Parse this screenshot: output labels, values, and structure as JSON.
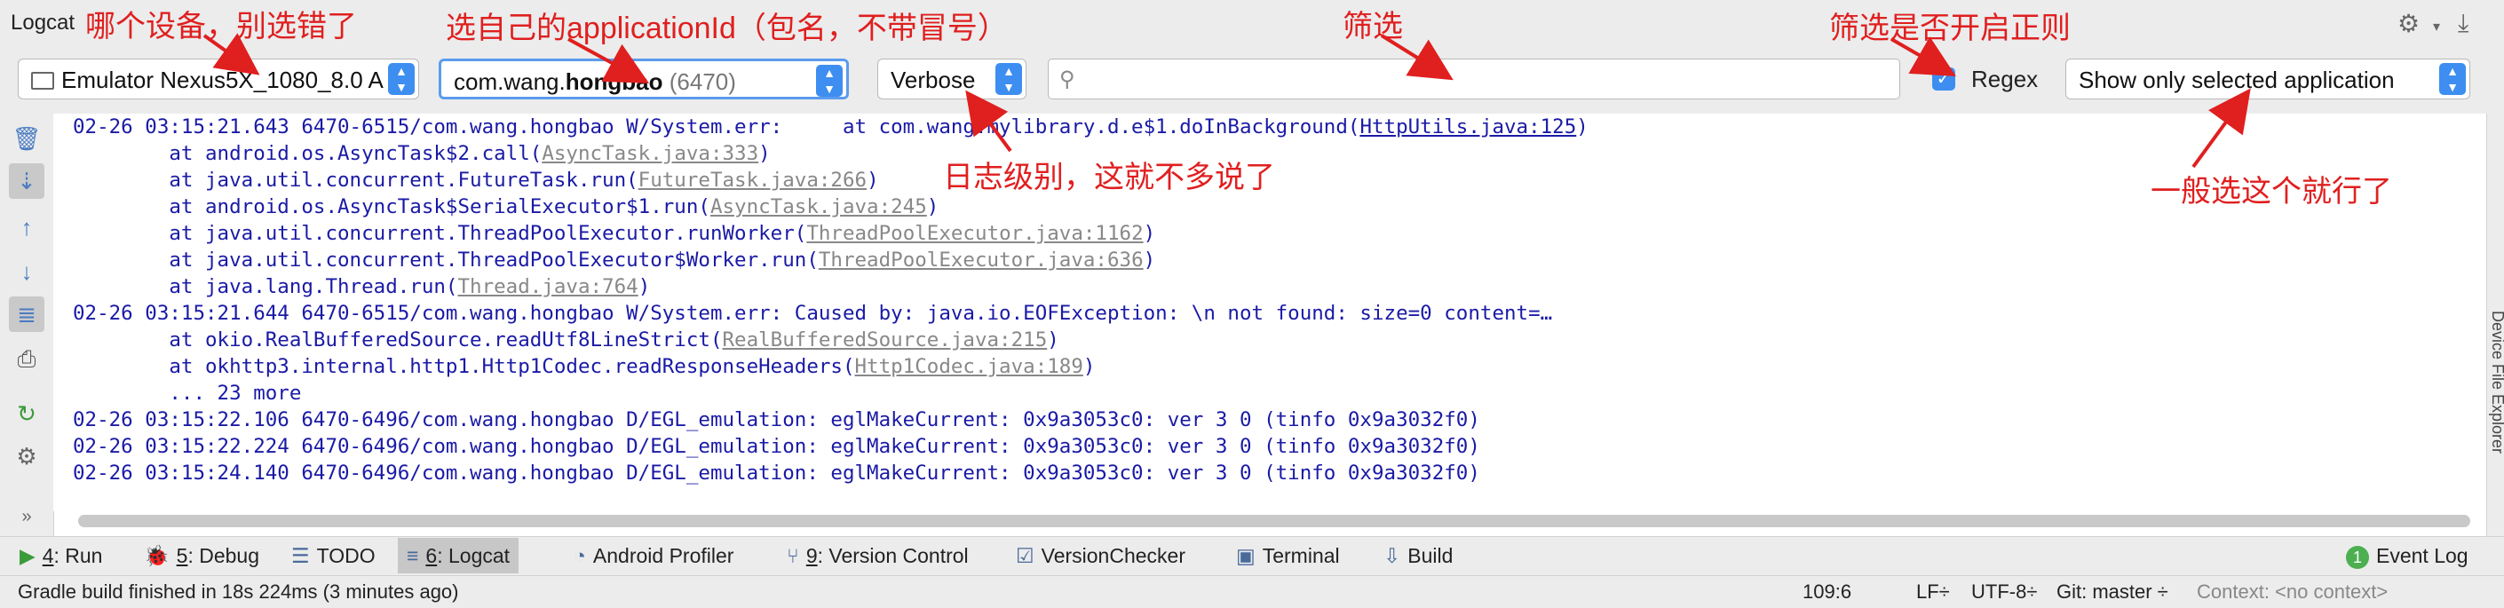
{
  "window": {
    "title": "Logcat"
  },
  "toolbar": {
    "device": "Emulator Nexus5X_1080_8.0 A",
    "app_package_prefix": "com.wang.",
    "app_package_bold": "hongbao",
    "app_pid": "(6470)",
    "log_level": "Verbose",
    "search_value": "",
    "regex_label": "Regex",
    "regex_checked": true,
    "filter_mode": "Show only selected application"
  },
  "log_lines": [
    {
      "text": "02-26 03:15:21.643 6470-6515/com.wang.hongbao W/System.err:     at com.wang.mylibrary.d.e$1.doInBackground(",
      "link": "HttpUtils.java:125",
      "suffix": ")",
      "link_style": "blue"
    },
    {
      "text": "        at android.os.AsyncTask$2.call(",
      "link": "AsyncTask.java:333",
      "suffix": ")",
      "link_style": "grey"
    },
    {
      "text": "        at java.util.concurrent.FutureTask.run(",
      "link": "FutureTask.java:266",
      "suffix": ")",
      "link_style": "grey"
    },
    {
      "text": "        at android.os.AsyncTask$SerialExecutor$1.run(",
      "link": "AsyncTask.java:245",
      "suffix": ")",
      "link_style": "grey"
    },
    {
      "text": "        at java.util.concurrent.ThreadPoolExecutor.runWorker(",
      "link": "ThreadPoolExecutor.java:1162",
      "suffix": ")",
      "link_style": "grey"
    },
    {
      "text": "        at java.util.concurrent.ThreadPoolExecutor$Worker.run(",
      "link": "ThreadPoolExecutor.java:636",
      "suffix": ")",
      "link_style": "grey"
    },
    {
      "text": "        at java.lang.Thread.run(",
      "link": "Thread.java:764",
      "suffix": ")",
      "link_style": "grey"
    },
    {
      "text": "02-26 03:15:21.644 6470-6515/com.wang.hongbao W/System.err: Caused by: java.io.EOFException: \\n not found: size=0 content=…",
      "link": "",
      "suffix": "",
      "link_style": "none"
    },
    {
      "text": "        at okio.RealBufferedSource.readUtf8LineStrict(",
      "link": "RealBufferedSource.java:215",
      "suffix": ")",
      "link_style": "grey"
    },
    {
      "text": "        at okhttp3.internal.http1.Http1Codec.readResponseHeaders(",
      "link": "Http1Codec.java:189",
      "suffix": ")",
      "link_style": "grey"
    },
    {
      "text": "        ... 23 more",
      "link": "",
      "suffix": "",
      "link_style": "none"
    },
    {
      "text": "02-26 03:15:22.106 6470-6496/com.wang.hongbao D/EGL_emulation: eglMakeCurrent: 0x9a3053c0: ver 3 0 (tinfo 0x9a3032f0)",
      "link": "",
      "suffix": "",
      "link_style": "none"
    },
    {
      "text": "02-26 03:15:22.224 6470-6496/com.wang.hongbao D/EGL_emulation: eglMakeCurrent: 0x9a3053c0: ver 3 0 (tinfo 0x9a3032f0)",
      "link": "",
      "suffix": "",
      "link_style": "none"
    },
    {
      "text": "02-26 03:15:24.140 6470-6496/com.wang.hongbao D/EGL_emulation: eglMakeCurrent: 0x9a3053c0: ver 3 0 (tinfo 0x9a3032f0)",
      "link": "",
      "suffix": "",
      "link_style": "none"
    }
  ],
  "right_strip_label": "Device File Explorer",
  "tabs": [
    {
      "key": "4",
      "label": ": Run",
      "icon": "run-icon"
    },
    {
      "key": "5",
      "label": ": Debug",
      "icon": "debug-icon"
    },
    {
      "key": "",
      "label": "TODO",
      "icon": "todo-icon"
    },
    {
      "key": "6",
      "label": ": Logcat",
      "icon": "logcat-icon",
      "active": true
    },
    {
      "key": "",
      "label": "Android Profiler",
      "icon": "profiler-icon"
    },
    {
      "key": "9",
      "label": ": Version Control",
      "icon": "version-control-icon"
    },
    {
      "key": "",
      "label": "VersionChecker",
      "icon": "version-checker-icon"
    },
    {
      "key": "",
      "label": "Terminal",
      "icon": "terminal-icon"
    },
    {
      "key": "",
      "label": "Build",
      "icon": "build-icon"
    }
  ],
  "event_log": {
    "badge": "1",
    "label": "Event Log"
  },
  "status": {
    "message": "Gradle build finished in 18s 224ms (3 minutes ago)",
    "position": "109:6",
    "line_sep": "LF÷",
    "encoding": "UTF-8÷",
    "git": "Git: master ÷",
    "context": "Context: <no context>"
  },
  "annotations": {
    "device": "哪个设备，别选错了",
    "app": "选自己的applicationId（包名，不带冒号）",
    "filter": "筛选",
    "regex": "筛选是否开启正则",
    "level": "日志级别，这就不多说了",
    "mode": "一般选这个就行了"
  },
  "colors": {
    "annotation": "#e01f1f",
    "accent": "#3d8ef0",
    "log_text": "#1a1aa6"
  }
}
